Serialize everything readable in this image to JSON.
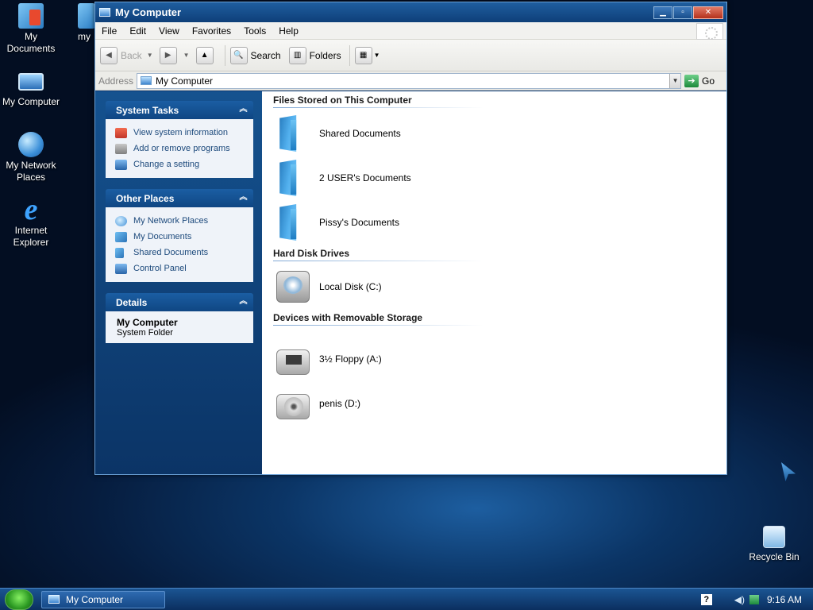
{
  "desktop": {
    "icons": [
      {
        "name": "My Documents",
        "label_line1": "My",
        "label_line2": "Documents"
      },
      {
        "name": "my",
        "label": "my"
      },
      {
        "name": "My Computer",
        "label": "My Computer"
      },
      {
        "name": "My Network Places",
        "label_line1": "My Network",
        "label_line2": "Places"
      },
      {
        "name": "Internet Explorer",
        "label_line1": "Internet",
        "label_line2": "Explorer",
        "glyph": "e"
      },
      {
        "name": "Recycle Bin",
        "label": "Recycle Bin"
      }
    ]
  },
  "window": {
    "title": "My Computer",
    "controls": {
      "minimize": "▁",
      "maximize": "▫",
      "close": "✕"
    },
    "menu": [
      "File",
      "Edit",
      "View",
      "Favorites",
      "Tools",
      "Help"
    ],
    "toolbar": {
      "back_label": "Back",
      "search_label": "Search",
      "folders_label": "Folders",
      "back_icon": "◀",
      "forward_icon": "▶",
      "dropdown_icon": "▼",
      "up_icon": "▲",
      "search_icon": "🔍",
      "folders_icon": "▥",
      "views_icon": "▦"
    },
    "address": {
      "label": "Address",
      "value": "My Computer",
      "go_label": "Go",
      "go_icon": "➔",
      "dropdown_icon": "▼"
    },
    "task_pane": {
      "system_tasks": {
        "title": "System Tasks",
        "collapse_icon": "︽",
        "links": [
          "View system information",
          "Add or remove programs",
          "Change a setting"
        ]
      },
      "other_places": {
        "title": "Other Places",
        "collapse_icon": "︽",
        "links": [
          "My Network Places",
          "My Documents",
          "Shared Documents",
          "Control Panel"
        ]
      },
      "details": {
        "title": "Details",
        "collapse_icon": "︽",
        "name": "My Computer",
        "type": "System Folder"
      }
    },
    "content": {
      "sections": [
        {
          "title": "Files Stored on This Computer",
          "items": [
            "Shared Documents",
            "2 USER's Documents",
            "Pissy's Documents"
          ]
        },
        {
          "title": "Hard Disk Drives",
          "items": [
            "Local Disk (C:)"
          ]
        },
        {
          "title": "Devices with Removable Storage",
          "items": [
            "3½ Floppy (A:)",
            "penis (D:)"
          ]
        }
      ]
    }
  },
  "taskbar": {
    "task_button_label": "My Computer",
    "help_icon": "?",
    "volume_icon": "◀)",
    "clock": "9:16 AM"
  },
  "colors": {
    "titlebar": "#0e3f79",
    "task_pane_bg": "#0b3466",
    "link": "#1d4a7c",
    "taskbar": "#0b2f5f"
  }
}
